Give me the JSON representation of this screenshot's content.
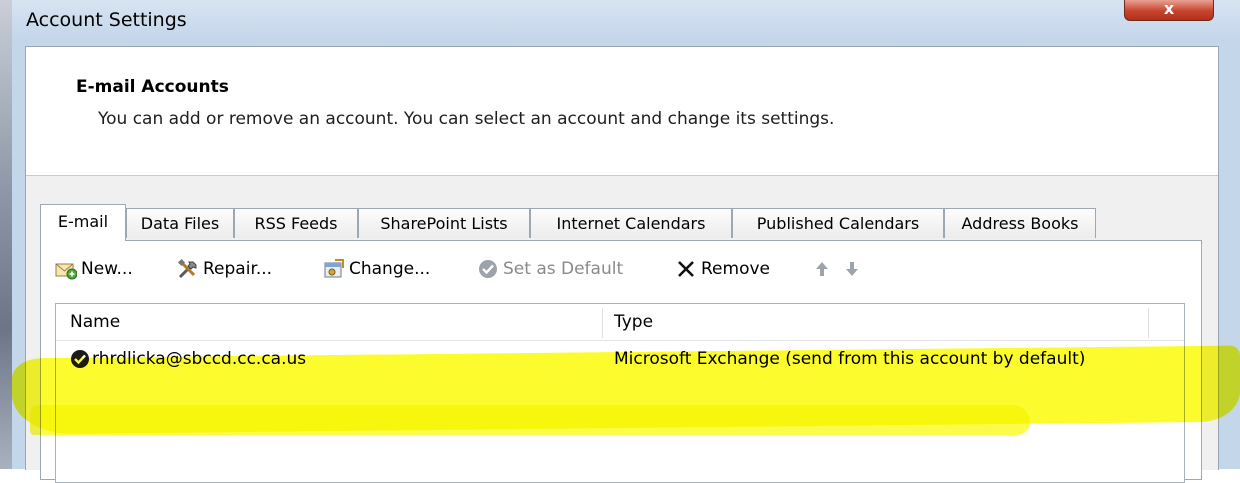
{
  "window": {
    "title": "Account Settings",
    "close_label": "x"
  },
  "header": {
    "title": "E-mail Accounts",
    "description": "You can add or remove an account. You can select an account and change its settings."
  },
  "tabs": [
    {
      "label": "E-mail",
      "active": true
    },
    {
      "label": "Data Files",
      "active": false
    },
    {
      "label": "RSS Feeds",
      "active": false
    },
    {
      "label": "SharePoint Lists",
      "active": false
    },
    {
      "label": "Internet Calendars",
      "active": false
    },
    {
      "label": "Published Calendars",
      "active": false
    },
    {
      "label": "Address Books",
      "active": false
    }
  ],
  "toolbar": {
    "new_label": "New...",
    "repair_label": "Repair...",
    "change_label": "Change...",
    "set_default_label": "Set as Default",
    "remove_label": "Remove",
    "move_up_icon": "arrow-up-icon",
    "move_down_icon": "arrow-down-icon"
  },
  "accounts_list": {
    "columns": {
      "name": "Name",
      "type": "Type"
    },
    "rows": [
      {
        "name": "rhrdlicka@sbccd.cc.ca.us",
        "type": "Microsoft Exchange (send from this account by default)",
        "is_default": true
      }
    ]
  },
  "colors": {
    "highlight": "#fafa00",
    "accent": "#2e6da4",
    "close": "#c7442d"
  }
}
